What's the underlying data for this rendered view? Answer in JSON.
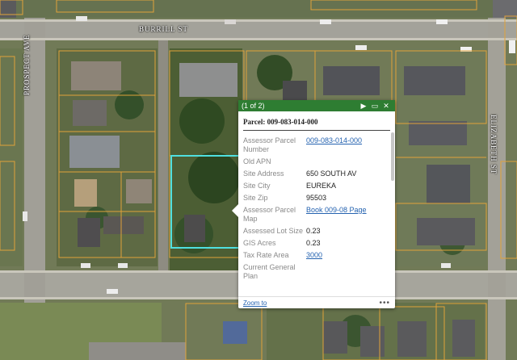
{
  "map": {
    "streets": {
      "burrill": "BURRILL ST",
      "prospect": "PROSPECT AVE",
      "elizabeth": "ELIZABETH ST"
    },
    "colors": {
      "parcel_line": "#e0a23a",
      "selection": "#4fe0e0",
      "road": "#9b9a93"
    }
  },
  "popup": {
    "count": "(1 of 2)",
    "controls": {
      "next": "▶",
      "maximize": "▭",
      "close": "✕"
    },
    "title": "Parcel: 009-083-014-000",
    "attributes": [
      {
        "label": "Assessor Parcel Number",
        "value": "009-083-014-000",
        "link": true
      },
      {
        "label": "Old APN",
        "value": "",
        "link": false
      },
      {
        "label": "Site Address",
        "value": "650 SOUTH AV",
        "link": false
      },
      {
        "label": "Site City",
        "value": "EUREKA",
        "link": false
      },
      {
        "label": "Site Zip",
        "value": "95503",
        "link": false
      },
      {
        "label": "Assessor Parcel Map",
        "value": "Book 009-08 Page",
        "link": true
      },
      {
        "label": "Assessed Lot Size",
        "value": "0.23",
        "link": false
      },
      {
        "label": "GIS Acres",
        "value": "0.23",
        "link": false
      },
      {
        "label": "Tax Rate Area",
        "value": "3000",
        "link": true
      },
      {
        "label": "Current General Plan",
        "value": "",
        "link": false
      }
    ],
    "footer": {
      "zoom": "Zoom to",
      "more": "•••"
    }
  }
}
